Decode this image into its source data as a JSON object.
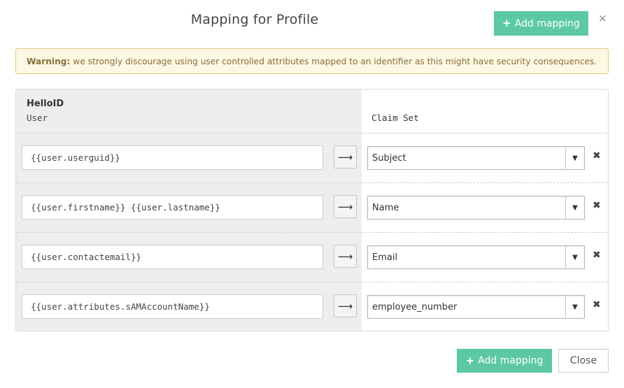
{
  "dialog": {
    "title": "Mapping for Profile",
    "close_icon": "×"
  },
  "toolbar": {
    "add_mapping_label": "Add mapping",
    "plus_icon": "+"
  },
  "warning": {
    "strong": "Warning:",
    "text": "we strongly discourage using user controlled attributes mapped to an identifier as this might have security consequences."
  },
  "table": {
    "left_header_title": "HelloID",
    "left_header_sub": "User",
    "right_header": "Claim Set",
    "arrow_icon": "⟶",
    "caret_icon": "▼",
    "delete_icon": "✖",
    "rows": [
      {
        "value": "{{user.userguid}}",
        "claim": "Subject"
      },
      {
        "value": "{{user.firstname}} {{user.lastname}}",
        "claim": "Name"
      },
      {
        "value": "{{user.contactemail}}",
        "claim": "Email"
      },
      {
        "value": "{{user.attributes.sAMAccountName}}",
        "claim": "employee_number"
      }
    ]
  },
  "footer": {
    "add_mapping_label": "Add mapping",
    "close_label": "Close"
  },
  "colors": {
    "accent": "#5cc8a5",
    "warning_bg": "#fcf8e3",
    "warning_text": "#8a6d3b"
  }
}
